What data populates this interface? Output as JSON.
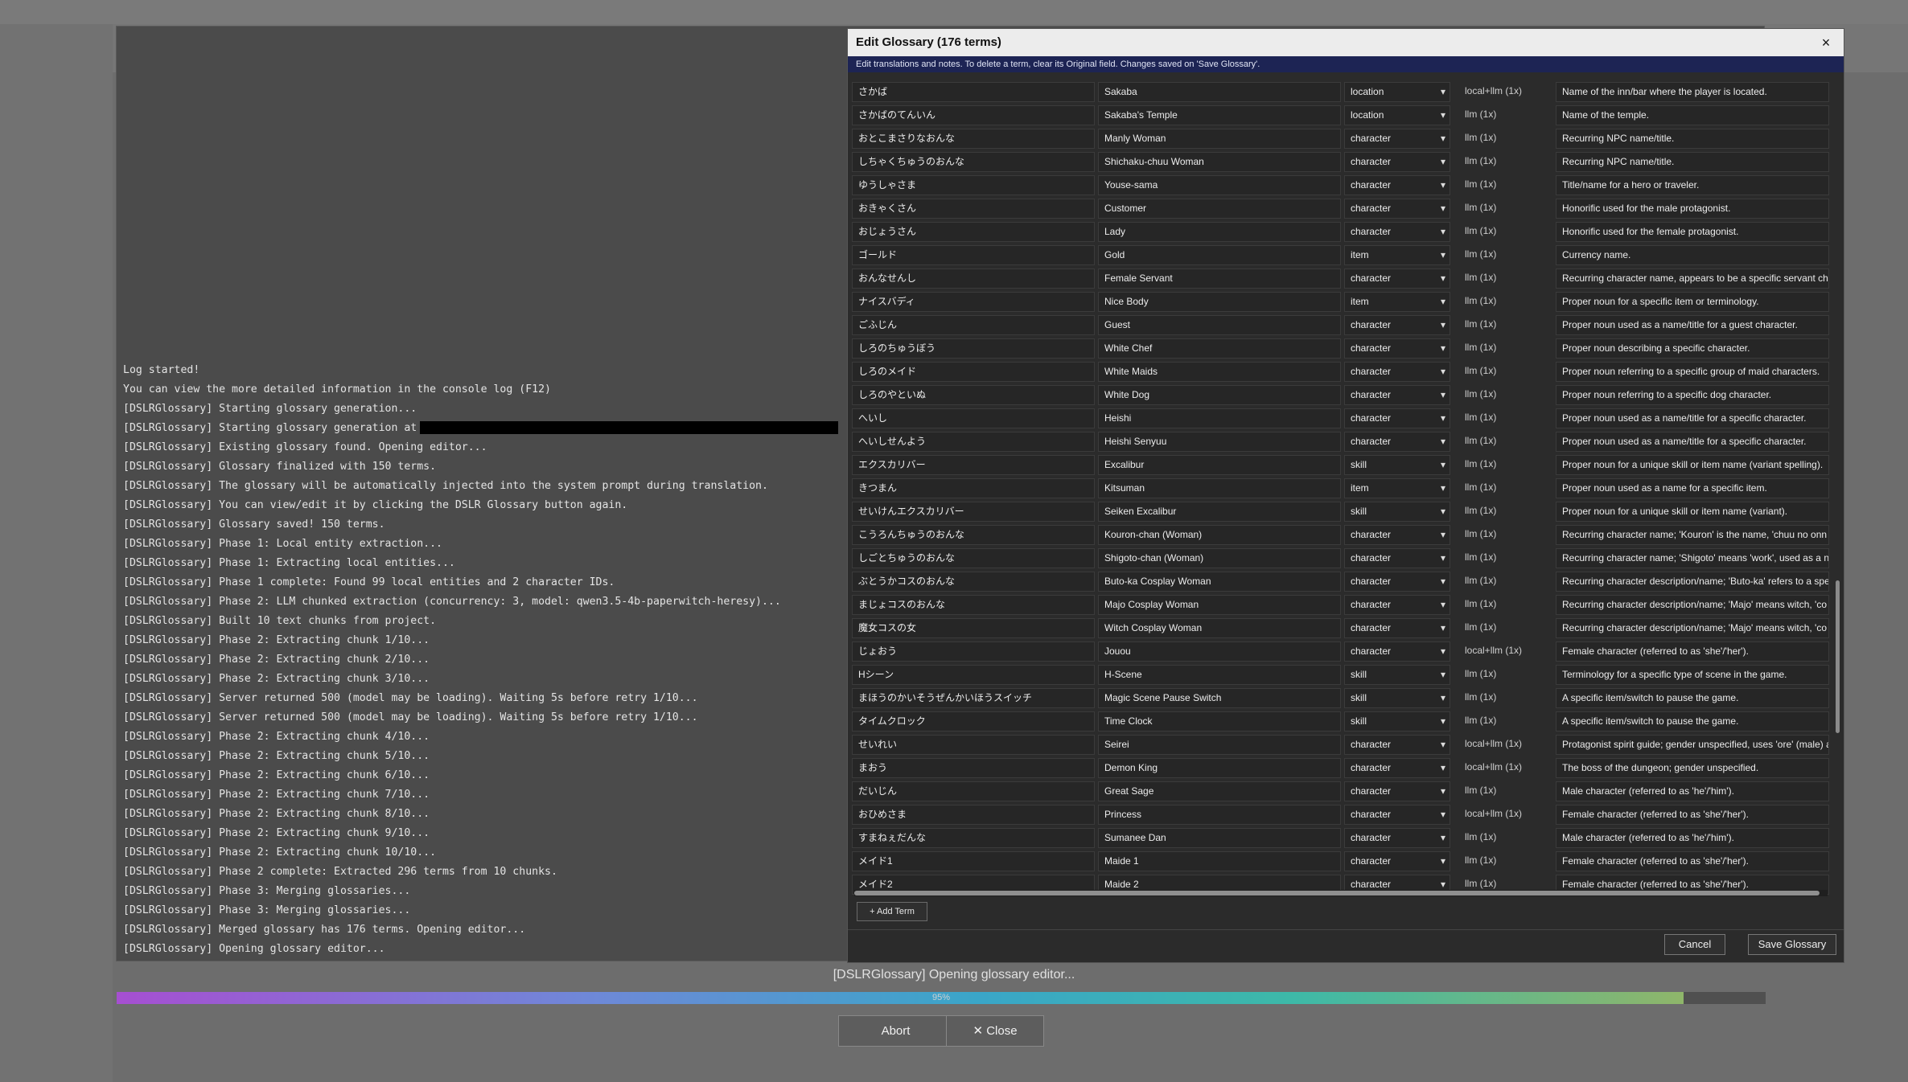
{
  "log": {
    "lines": [
      "Log started!",
      "You can view the more detailed information in the console log (F12)",
      "[DSLRGlossary] Starting glossary generation...",
      "[DSLRGlossary] Starting glossary generation at",
      "[DSLRGlossary] Existing glossary found. Opening editor...",
      "[DSLRGlossary] Glossary finalized with 150 terms.",
      "[DSLRGlossary] The glossary will be automatically injected into the system prompt during translation.",
      "[DSLRGlossary] You can view/edit it by clicking the DSLR Glossary button again.",
      "[DSLRGlossary] Glossary saved! 150 terms.",
      "[DSLRGlossary] Phase 1: Local entity extraction...",
      "[DSLRGlossary] Phase 1: Extracting local entities...",
      "[DSLRGlossary] Phase 1 complete: Found 99 local entities and 2 character IDs.",
      "[DSLRGlossary] Phase 2: LLM chunked extraction (concurrency: 3, model: qwen3.5-4b-paperwitch-heresy)...",
      "[DSLRGlossary] Built 10 text chunks from project.",
      "[DSLRGlossary] Phase 2: Extracting chunk 1/10...",
      "[DSLRGlossary] Phase 2: Extracting chunk 2/10...",
      "[DSLRGlossary] Phase 2: Extracting chunk 3/10...",
      "[DSLRGlossary] Server returned 500 (model may be loading). Waiting 5s before retry 1/10...",
      "[DSLRGlossary] Server returned 500 (model may be loading). Waiting 5s before retry 1/10...",
      "[DSLRGlossary] Phase 2: Extracting chunk 4/10...",
      "[DSLRGlossary] Phase 2: Extracting chunk 5/10...",
      "[DSLRGlossary] Phase 2: Extracting chunk 6/10...",
      "[DSLRGlossary] Phase 2: Extracting chunk 7/10...",
      "[DSLRGlossary] Phase 2: Extracting chunk 8/10...",
      "[DSLRGlossary] Phase 2: Extracting chunk 9/10...",
      "[DSLRGlossary] Phase 2: Extracting chunk 10/10...",
      "[DSLRGlossary] Phase 2 complete: Extracted 296 terms from 10 chunks.",
      "[DSLRGlossary] Phase 3: Merging glossaries...",
      "[DSLRGlossary] Phase 3: Merging glossaries...",
      "[DSLRGlossary] Merged glossary has 176 terms. Opening editor...",
      "[DSLRGlossary] Opening glossary editor..."
    ]
  },
  "status": {
    "text": "[DSLRGlossary] Opening glossary editor...",
    "progress_percent": 95,
    "progress_label": "95%"
  },
  "buttons": {
    "abort": "Abort",
    "close": "✕ Close"
  },
  "dialog": {
    "title": "Edit Glossary (176 terms)",
    "close_glyph": "×",
    "info": "Edit translations and notes. To delete a term, clear its Original field. Changes saved on 'Save Glossary'.",
    "add_term": "+ Add Term",
    "cancel": "Cancel",
    "save": "Save Glossary",
    "rows": [
      {
        "orig": "さかば",
        "trans": "Sakaba",
        "type": "location",
        "src": "local+llm (1x)",
        "note": "Name of the inn/bar where the player is located."
      },
      {
        "orig": "さかばのてんいん",
        "trans": "Sakaba's Temple",
        "type": "location",
        "src": "llm (1x)",
        "note": "Name of the temple."
      },
      {
        "orig": "おとこまさりなおんな",
        "trans": "Manly Woman",
        "type": "character",
        "src": "llm (1x)",
        "note": "Recurring NPC name/title."
      },
      {
        "orig": "しちゃくちゅうのおんな",
        "trans": "Shichaku-chuu Woman",
        "type": "character",
        "src": "llm (1x)",
        "note": "Recurring NPC name/title."
      },
      {
        "orig": "ゆうしゃさま",
        "trans": "Youse-sama",
        "type": "character",
        "src": "llm (1x)",
        "note": "Title/name for a hero or traveler."
      },
      {
        "orig": "おきゃくさん",
        "trans": "Customer",
        "type": "character",
        "src": "llm (1x)",
        "note": "Honorific used for the male protagonist."
      },
      {
        "orig": "おじょうさん",
        "trans": "Lady",
        "type": "character",
        "src": "llm (1x)",
        "note": "Honorific used for the female protagonist."
      },
      {
        "orig": "ゴールド",
        "trans": "Gold",
        "type": "item",
        "src": "llm (1x)",
        "note": "Currency name."
      },
      {
        "orig": "おんなせんし",
        "trans": "Female Servant",
        "type": "character",
        "src": "llm (1x)",
        "note": "Recurring character name, appears to be a specific servant ch"
      },
      {
        "orig": "ナイスバディ",
        "trans": "Nice Body",
        "type": "item",
        "src": "llm (1x)",
        "note": "Proper noun for a specific item or terminology."
      },
      {
        "orig": "ごふじん",
        "trans": "Guest",
        "type": "character",
        "src": "llm (1x)",
        "note": "Proper noun used as a name/title for a guest character."
      },
      {
        "orig": "しろのちゅうぼう",
        "trans": "White Chef",
        "type": "character",
        "src": "llm (1x)",
        "note": "Proper noun describing a specific character."
      },
      {
        "orig": "しろのメイド",
        "trans": "White Maids",
        "type": "character",
        "src": "llm (1x)",
        "note": "Proper noun referring to a specific group of maid characters."
      },
      {
        "orig": "しろのやといぬ",
        "trans": "White Dog",
        "type": "character",
        "src": "llm (1x)",
        "note": "Proper noun referring to a specific dog character."
      },
      {
        "orig": "へいし",
        "trans": "Heishi",
        "type": "character",
        "src": "llm (1x)",
        "note": "Proper noun used as a name/title for a specific character."
      },
      {
        "orig": "へいしせんよう",
        "trans": "Heishi Senyuu",
        "type": "character",
        "src": "llm (1x)",
        "note": "Proper noun used as a name/title for a specific character."
      },
      {
        "orig": "エクスカリバー",
        "trans": "Excalibur",
        "type": "skill",
        "src": "llm (1x)",
        "note": "Proper noun for a unique skill or item name (variant spelling)."
      },
      {
        "orig": "きつまん",
        "trans": "Kitsuman",
        "type": "item",
        "src": "llm (1x)",
        "note": "Proper noun used as a name for a specific item."
      },
      {
        "orig": "せいけんエクスカリバー",
        "trans": "Seiken Excalibur",
        "type": "skill",
        "src": "llm (1x)",
        "note": "Proper noun for a unique skill or item name (variant)."
      },
      {
        "orig": "こうろんちゅうのおんな",
        "trans": "Kouron-chan (Woman)",
        "type": "character",
        "src": "llm (1x)",
        "note": "Recurring character name; 'Kouron' is the name, 'chuu no onn"
      },
      {
        "orig": "しごとちゅうのおんな",
        "trans": "Shigoto-chan (Woman)",
        "type": "character",
        "src": "llm (1x)",
        "note": "Recurring character name; 'Shigoto' means 'work', used as a n"
      },
      {
        "orig": "ぶとうかコスのおんな",
        "trans": "Buto-ka Cosplay Woman",
        "type": "character",
        "src": "llm (1x)",
        "note": "Recurring character description/name; 'Buto-ka' refers to a spe"
      },
      {
        "orig": "まじょコスのおんな",
        "trans": "Majo Cosplay Woman",
        "type": "character",
        "src": "llm (1x)",
        "note": "Recurring character description/name; 'Majo' means witch, 'co"
      },
      {
        "orig": "魔女コスの女",
        "trans": "Witch Cosplay Woman",
        "type": "character",
        "src": "llm (1x)",
        "note": "Recurring character description/name; 'Majo' means witch, 'co"
      },
      {
        "orig": "じょおう",
        "trans": "Jouou",
        "type": "character",
        "src": "local+llm (1x)",
        "note": "Female character (referred to as 'she'/'her')."
      },
      {
        "orig": "Hシーン",
        "trans": "H-Scene",
        "type": "skill",
        "src": "llm (1x)",
        "note": "Terminology for a specific type of scene in the game."
      },
      {
        "orig": "まほうのかいそうぜんかいほうスイッチ",
        "trans": "Magic Scene Pause Switch",
        "type": "skill",
        "src": "llm (1x)",
        "note": "A specific item/switch to pause the game."
      },
      {
        "orig": "タイムクロック",
        "trans": "Time Clock",
        "type": "skill",
        "src": "llm (1x)",
        "note": "A specific item/switch to pause the game."
      },
      {
        "orig": "せいれい",
        "trans": "Seirei",
        "type": "character",
        "src": "local+llm (1x)",
        "note": "Protagonist spirit guide; gender unspecified, uses 'ore' (male) a"
      },
      {
        "orig": "まおう",
        "trans": "Demon King",
        "type": "character",
        "src": "local+llm (1x)",
        "note": "The boss of the dungeon; gender unspecified."
      },
      {
        "orig": "だいじん",
        "trans": "Great Sage",
        "type": "character",
        "src": "llm (1x)",
        "note": "Male character (referred to as 'he'/'him')."
      },
      {
        "orig": "おひめさま",
        "trans": "Princess",
        "type": "character",
        "src": "local+llm (1x)",
        "note": "Female character (referred to as 'she'/'her')."
      },
      {
        "orig": "すまねぇだんな",
        "trans": "Sumanee Dan",
        "type": "character",
        "src": "llm (1x)",
        "note": "Male character (referred to as 'he'/'him')."
      },
      {
        "orig": "メイド1",
        "trans": "Maide 1",
        "type": "character",
        "src": "llm (1x)",
        "note": "Female character (referred to as 'she'/'her')."
      },
      {
        "orig": "メイド2",
        "trans": "Maide 2",
        "type": "character",
        "src": "llm (1x)",
        "note": "Female character (referred to as 'she'/'her')."
      }
    ]
  }
}
